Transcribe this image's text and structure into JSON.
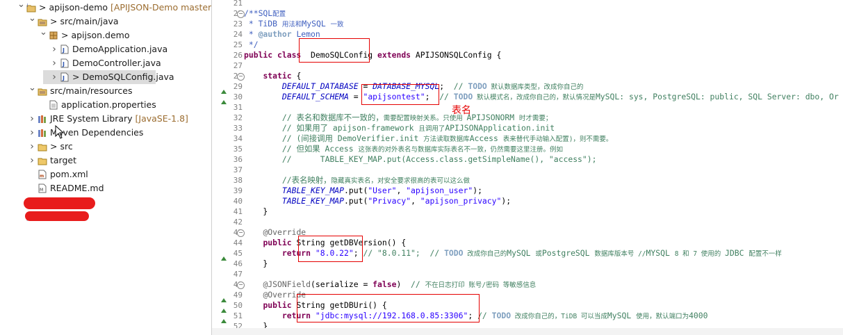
{
  "explorer": {
    "items": [
      {
        "label": "> apijson-demo",
        "deco": " [APIJSON-Demo master]",
        "indent": 0,
        "twisty": "v",
        "icon": "project"
      },
      {
        "label": "> src/main/java",
        "deco": "",
        "indent": 1,
        "twisty": "v",
        "icon": "srcfolder"
      },
      {
        "label": "> apijson.demo",
        "deco": "",
        "indent": 2,
        "twisty": "v",
        "icon": "package"
      },
      {
        "label": "DemoApplication.java",
        "deco": "",
        "indent": 3,
        "twisty": ">",
        "icon": "java"
      },
      {
        "label": "DemoController.java",
        "deco": "",
        "indent": 3,
        "twisty": ">",
        "icon": "java"
      },
      {
        "label": "> DemoSQLConfig.java",
        "deco": "",
        "indent": 3,
        "twisty": ">",
        "icon": "java",
        "selected": true
      },
      {
        "label": "src/main/resources",
        "deco": "",
        "indent": 1,
        "twisty": "v",
        "icon": "srcfolder"
      },
      {
        "label": "application.properties",
        "deco": "",
        "indent": 2,
        "twisty": "",
        "icon": "file"
      },
      {
        "label": "JRE System Library",
        "deco": " [JavaSE-1.8]",
        "indent": 1,
        "twisty": ">",
        "icon": "library"
      },
      {
        "label": "Maven Dependencies",
        "deco": "",
        "indent": 1,
        "twisty": ">",
        "icon": "library"
      },
      {
        "label": "> src",
        "deco": "",
        "indent": 1,
        "twisty": ">",
        "icon": "folder"
      },
      {
        "label": "target",
        "deco": "",
        "indent": 1,
        "twisty": ">",
        "icon": "folder"
      },
      {
        "label": "pom.xml",
        "deco": "",
        "indent": 1,
        "twisty": "",
        "icon": "xml"
      },
      {
        "label": "README.md",
        "deco": "",
        "indent": 1,
        "twisty": "",
        "icon": "md"
      },
      {
        "label": "",
        "deco": "",
        "indent": 0,
        "twisty": "",
        "icon": "workset"
      },
      {
        "label": "",
        "deco": "",
        "indent": 0,
        "twisty": "",
        "icon": "workset"
      }
    ]
  },
  "editor": {
    "line_numbers": [
      "21",
      "22",
      "23",
      "24",
      "25",
      "26",
      "27",
      "28",
      "29",
      "30",
      "31",
      "32",
      "33",
      "34",
      "35",
      "36",
      "37",
      "38",
      "39",
      "40",
      "41",
      "42",
      "43",
      "44",
      "45",
      "46",
      "47",
      "48",
      "49",
      "50",
      "51",
      "52"
    ],
    "code_lines": [
      [],
      [
        [
          "jd",
          "/**SQL"
        ],
        [
          "jd sm",
          "配置"
        ]
      ],
      [
        [
          "jd",
          " * TiDB "
        ],
        [
          "jd sm",
          "用法和"
        ],
        [
          "jd",
          "MySQL "
        ],
        [
          "jd sm",
          "一致"
        ]
      ],
      [
        [
          "jd",
          " * "
        ],
        [
          "tg",
          "@author"
        ],
        [
          "jd",
          " Lemon"
        ]
      ],
      [
        [
          "jd",
          " */"
        ]
      ],
      [
        [
          "kw",
          "public class"
        ],
        [
          "",
          "  DemoSQLConfig "
        ],
        [
          "kw",
          "extends"
        ],
        [
          "",
          " APIJSONSQLConfig {"
        ]
      ],
      [],
      [
        [
          "",
          "    "
        ],
        [
          "kw",
          "static"
        ],
        [
          "",
          " {"
        ]
      ],
      [
        [
          "",
          "        "
        ],
        [
          "fd",
          "DEFAULT_DATABASE"
        ],
        [
          "",
          " = "
        ],
        [
          "fd",
          "DATABASE_MYSQL"
        ],
        [
          ";  "
        ],
        [
          "cm",
          "// "
        ],
        [
          "tg",
          "TODO"
        ],
        [
          "cm sm",
          " 默认数据库类型，改成你自己的"
        ]
      ],
      [
        [
          "",
          "        "
        ],
        [
          "fd",
          "DEFAULT_SCHEMA"
        ],
        [
          "",
          " = "
        ],
        [
          "st",
          "\"apijsontest\""
        ],
        [
          ";  "
        ],
        [
          "cm",
          "// "
        ],
        [
          "tg",
          "TODO"
        ],
        [
          "cm sm",
          " 默认模式名，改成你自己的，默认情况是"
        ],
        [
          "cm",
          "MySQL: sys, PostgreSQL: public, SQL Server: dbo, Or"
        ]
      ],
      [],
      [
        [
          "",
          "        "
        ],
        [
          "cm",
          "// 表名和数据库不一致的，"
        ],
        [
          "cm sm",
          "需要配置映射关系。只使用 "
        ],
        [
          "cm",
          "APIJSONORM "
        ],
        [
          "cm sm",
          "时才需要；"
        ]
      ],
      [
        [
          "",
          "        "
        ],
        [
          "cm",
          "// 如果用了 apijson-framework "
        ],
        [
          "cm sm",
          "且调用了"
        ],
        [
          "cm",
          "APIJSONApplication.init"
        ]
      ],
      [
        [
          "",
          "        "
        ],
        [
          "cm",
          "// (间接调用 DemoVerifier.init "
        ],
        [
          "cm sm",
          "方法读取数据库"
        ],
        [
          "cm",
          "Access "
        ],
        [
          "cm sm",
          "表来替代手动输入配置)，则不需要。"
        ]
      ],
      [
        [
          "",
          "        "
        ],
        [
          "cm",
          "// 但如果 Access "
        ],
        [
          "cm sm",
          "这张表的对外表名与数据库实际表名不一致，仍然需要这里注册。例如"
        ]
      ],
      [
        [
          "",
          "        "
        ],
        [
          "cm",
          "//      TABLE_KEY_MAP.put(Access.class.getSimpleName(), \"access\");"
        ]
      ],
      [],
      [
        [
          "",
          "        "
        ],
        [
          "cm",
          "//表名映射，"
        ],
        [
          "cm sm",
          "隐藏真实表名，对安全要求很高的表可以这么做"
        ]
      ],
      [
        [
          "",
          "        "
        ],
        [
          "fd",
          "TABLE_KEY_MAP"
        ],
        [
          ".put("
        ],
        [
          "st",
          "\"User\""
        ],
        [
          ", "
        ],
        [
          "st",
          "\"apijson_user\""
        ],
        [
          ");"
        ]
      ],
      [
        [
          "",
          "        "
        ],
        [
          "fd",
          "TABLE_KEY_MAP"
        ],
        [
          ".put("
        ],
        [
          "st",
          "\"Privacy\""
        ],
        [
          ", "
        ],
        [
          "st",
          "\"apijson_privacy\""
        ],
        [
          ");"
        ]
      ],
      [
        [
          "",
          "    }"
        ]
      ],
      [],
      [
        [
          "",
          "    "
        ],
        [
          "an",
          "@Override"
        ]
      ],
      [
        [
          "",
          "    "
        ],
        [
          "kw",
          "public"
        ],
        [
          " String getDBVersion() {"
        ]
      ],
      [
        [
          "",
          "        "
        ],
        [
          "kw",
          "return"
        ],
        [
          " "
        ],
        [
          "st",
          "\"8.0.22\""
        ],
        [
          "; "
        ],
        [
          "cm",
          "// \"8.0.11\";  // "
        ],
        [
          "tg",
          "TODO"
        ],
        [
          "cm sm",
          " 改成你自己的"
        ],
        [
          "cm",
          "MySQL "
        ],
        [
          "cm sm",
          "或"
        ],
        [
          "cm",
          "PostgreSQL "
        ],
        [
          "cm sm",
          "数据库版本号 //"
        ],
        [
          "cm",
          "MYSQL "
        ],
        [
          "cm sm",
          "8 和 7 使用的 "
        ],
        [
          "cm",
          "JDBC "
        ],
        [
          "cm sm",
          "配置不一样"
        ]
      ],
      [
        [
          "",
          "    }"
        ]
      ],
      [],
      [
        [
          "",
          "    "
        ],
        [
          "an",
          "@JSONField"
        ],
        [
          "(serialize = "
        ],
        [
          "kw",
          "false"
        ],
        [
          ")  "
        ],
        [
          "cm",
          "// "
        ],
        [
          "cm sm",
          "不在日志打印 账号/密码 等敏感信息"
        ]
      ],
      [
        [
          "",
          "    "
        ],
        [
          "an",
          "@Override"
        ]
      ],
      [
        [
          "",
          "    "
        ],
        [
          "kw",
          "public"
        ],
        [
          " String getDBUri() {"
        ]
      ],
      [
        [
          "",
          "        "
        ],
        [
          "kw",
          "return"
        ],
        [
          " "
        ],
        [
          "st",
          "\"jdbc:mysql://192.168.0.85:3306\""
        ],
        [
          "; "
        ],
        [
          "cm",
          "// "
        ],
        [
          "tg",
          "TODO"
        ],
        [
          "cm sm",
          " 改成你自己的，TiDB 可以当成"
        ],
        [
          "cm",
          "MySQL "
        ],
        [
          "cm sm",
          "使用，默认端口为"
        ],
        [
          "cm",
          "4000"
        ]
      ],
      [
        [
          "",
          "    }"
        ]
      ]
    ],
    "annotation_label": "表名"
  }
}
